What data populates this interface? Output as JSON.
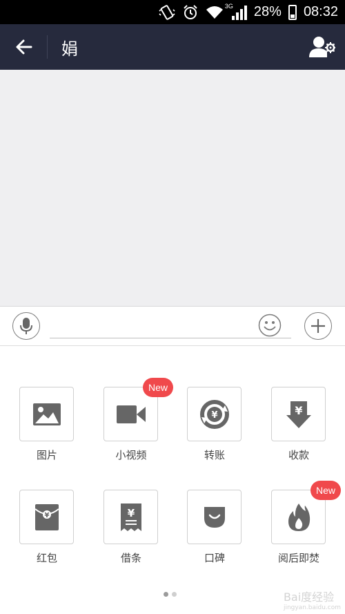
{
  "status_bar": {
    "network": "3G",
    "battery": "28%",
    "time": "08:32",
    "icons": [
      "vibrate-icon",
      "alarm-icon",
      "wifi-icon",
      "signal-icon",
      "battery-icon"
    ]
  },
  "header": {
    "title": "娟",
    "background": "#262a3d",
    "back_icon": "back-arrow-icon",
    "profile_icon": "profile-settings-icon"
  },
  "chat": {
    "background": "#efeff1"
  },
  "input_bar": {
    "voice_icon": "microphone-icon",
    "emoji_icon": "emoji-icon",
    "plus_icon": "plus-icon",
    "text_value": ""
  },
  "panel": {
    "tiles": [
      {
        "label": "图片",
        "icon": "image-icon",
        "badge": ""
      },
      {
        "label": "小视频",
        "icon": "video-camera-icon",
        "badge": "New"
      },
      {
        "label": "转账",
        "icon": "transfer-icon",
        "badge": ""
      },
      {
        "label": "收款",
        "icon": "receive-money-icon",
        "badge": ""
      },
      {
        "label": "红包",
        "icon": "red-envelope-icon",
        "badge": ""
      },
      {
        "label": "借条",
        "icon": "iou-receipt-icon",
        "badge": ""
      },
      {
        "label": "口碑",
        "icon": "koubei-icon",
        "badge": ""
      },
      {
        "label": "阅后即焚",
        "icon": "burn-after-reading-icon",
        "badge": "New"
      }
    ],
    "badge_color": "#f0494c",
    "page_count": 2,
    "current_page": 1
  },
  "watermark": {
    "text": "Bai度经验",
    "url": "jingyan.baidu.com"
  }
}
